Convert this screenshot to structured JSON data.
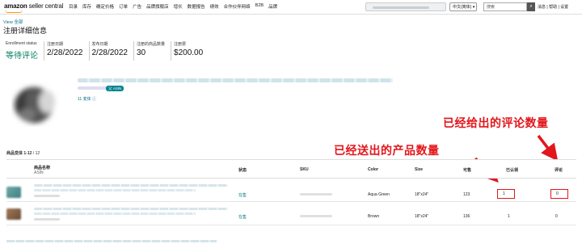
{
  "nav": {
    "logo_bold": "amazon",
    "logo_rest": " seller central",
    "items": [
      "目录",
      "库存",
      "确定价格",
      "订单",
      "广告",
      "品牌旗舰店",
      "增长",
      "数据报告",
      "绩效",
      "合作伙伴网络",
      "B2B",
      "品牌"
    ],
    "language": "中文(简体) ▾",
    "search_placeholder": "搜索",
    "search_icon": "magnifier-icon",
    "links": "消息 | 帮助 | 设置"
  },
  "breadcrumb": "View 全部",
  "page_title": "注册详细信息",
  "summary": [
    {
      "label": "Enrollment status",
      "value": "等待评论"
    },
    {
      "label": "注册日期",
      "value": "2/28/2022"
    },
    {
      "label": "发布日期",
      "value": "2/28/2022"
    },
    {
      "label": "注册的商品数量",
      "value": "30"
    },
    {
      "label": "注册费",
      "value": "$200.00"
    }
  ],
  "product": {
    "asin_badge": "父 ASIN",
    "variants": "11 变体 ⓘ"
  },
  "annotations": {
    "reviews_given": "已经给出的评论数量",
    "units_sent": "已经送出的产品数量"
  },
  "count": {
    "range": "商品变体 1-12",
    "total": " / 12"
  },
  "table": {
    "headers": [
      "商品名称",
      "状态",
      "SKU",
      "Color",
      "Size",
      "可售",
      "已认领",
      "评论"
    ],
    "header_sub": "ASIN",
    "rows": [
      {
        "status": "在售",
        "color": "Aqua Green",
        "size": "18\"x24\"",
        "available": "123",
        "claimed": "1",
        "reviews": "0"
      },
      {
        "status": "在售",
        "color": "Brown",
        "size": "18\"x24\"",
        "available": "136",
        "claimed": "1",
        "reviews": "0"
      }
    ]
  }
}
